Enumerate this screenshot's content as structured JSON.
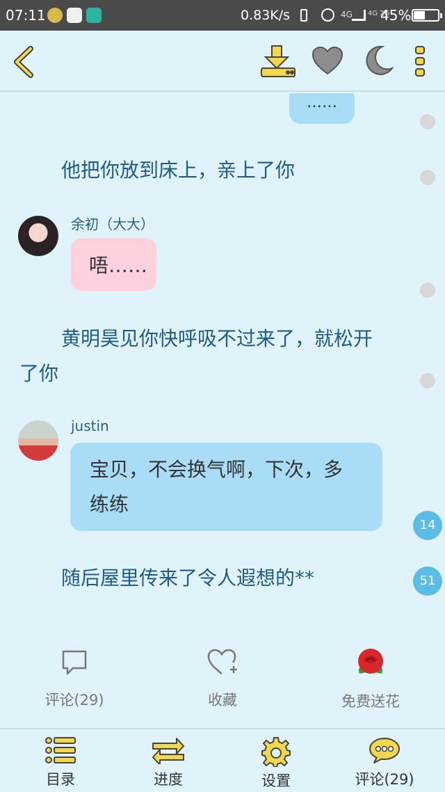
{
  "status_bar": {
    "time": "07:11",
    "network_speed": "0.83K/s",
    "signal_1": "4G",
    "signal_2": "4G 2G",
    "battery": "45%"
  },
  "toolbar": {
    "back_icon": "chevron-left-icon",
    "download_icon": "download-icon",
    "favorite_icon": "heart-icon",
    "night_mode_icon": "moon-icon",
    "more_icon": "more-vertical-icon"
  },
  "story": {
    "top_partial_bubble": "……",
    "narration_1": "他把你放到床上，亲上了你",
    "msg_1": {
      "name": "余初（大大）",
      "text": "唔……"
    },
    "narration_2_line1": "黄明昊见你快呼吸不过来了，就松开",
    "narration_2_line2": "了你",
    "msg_2": {
      "name": "justin",
      "text_line1": "宝贝，不会换气啊，下次，多",
      "text_line2": "练练"
    },
    "narration_3": "随后屋里传来了令人遐想的**"
  },
  "side_badges": {
    "badge_1": "14",
    "badge_2": "51"
  },
  "actions": {
    "comment": "评论(29)",
    "collect": "收藏",
    "send_flower": "免费送花"
  },
  "tabs": {
    "catalog": "目录",
    "progress": "进度",
    "settings": "设置",
    "comments": "评论(29)"
  },
  "colors": {
    "background": "#e0f3fb",
    "narration_text": "#1e5a8c",
    "pink_bubble": "#ffd1dc",
    "blue_bubble": "#a9dcf7",
    "accent_yellow": "#f2d84a",
    "badge_blue": "#5bbde6"
  }
}
